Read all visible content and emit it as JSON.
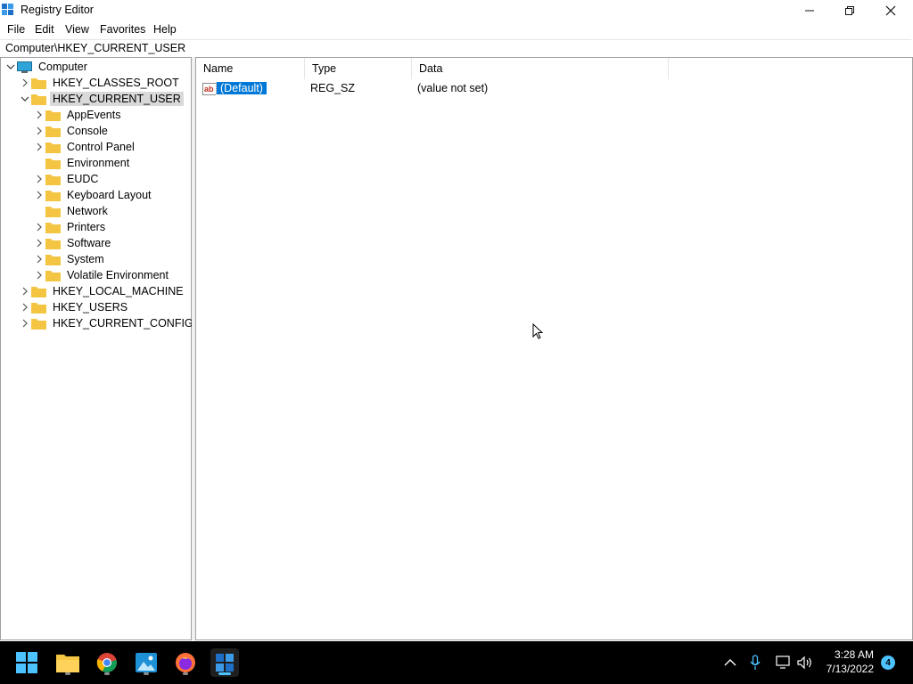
{
  "window": {
    "title": "Registry Editor",
    "icon": "registry-editor-icon"
  },
  "menu": [
    "File",
    "Edit",
    "View",
    "Favorites",
    "Help"
  ],
  "address": "Computer\\HKEY_CURRENT_USER",
  "tree": {
    "root": "Computer",
    "hives": [
      {
        "label": "HKEY_CLASSES_ROOT",
        "expanded": false
      },
      {
        "label": "HKEY_CURRENT_USER",
        "expanded": true,
        "selected": true
      },
      {
        "label": "HKEY_LOCAL_MACHINE",
        "expanded": false
      },
      {
        "label": "HKEY_USERS",
        "expanded": false
      },
      {
        "label": "HKEY_CURRENT_CONFIG",
        "expanded": false
      }
    ],
    "current_user_children": [
      {
        "label": "AppEvents",
        "has_children": true
      },
      {
        "label": "Console",
        "has_children": true
      },
      {
        "label": "Control Panel",
        "has_children": true
      },
      {
        "label": "Environment",
        "has_children": false
      },
      {
        "label": "EUDC",
        "has_children": true
      },
      {
        "label": "Keyboard Layout",
        "has_children": true
      },
      {
        "label": "Network",
        "has_children": false
      },
      {
        "label": "Printers",
        "has_children": true
      },
      {
        "label": "Software",
        "has_children": true
      },
      {
        "label": "System",
        "has_children": true
      },
      {
        "label": "Volatile Environment",
        "has_children": true
      }
    ]
  },
  "list": {
    "columns": [
      "Name",
      "Type",
      "Data"
    ],
    "rows": [
      {
        "name": "(Default)",
        "type": "REG_SZ",
        "data": "(value not set)",
        "icon": "string-value-icon"
      }
    ]
  },
  "taskbar": {
    "apps": [
      "start-icon",
      "file-explorer-icon",
      "chrome-icon",
      "photos-icon",
      "firefox-icon",
      "registry-editor-icon"
    ],
    "clock_time": "3:28 AM",
    "clock_date": "7/13/2022",
    "notification_count": "4"
  },
  "colors": {
    "selection": "#0078d7",
    "folder": "#f4c542",
    "taskbar": "#000000",
    "accent": "#4cc2ff"
  }
}
